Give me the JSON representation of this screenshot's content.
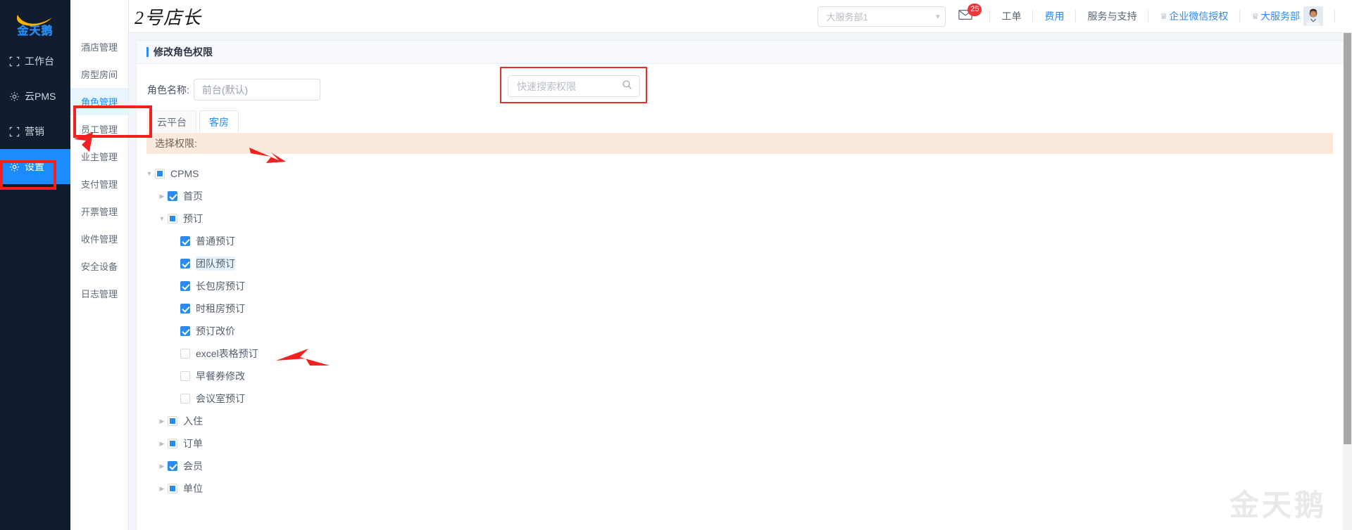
{
  "brand": {
    "name": "金天鹅",
    "logo_icon": "swan-swoosh-logo"
  },
  "rail": {
    "items": [
      {
        "label": "工作台",
        "icon": "workbench-icon",
        "active": false
      },
      {
        "label": "云PMS",
        "icon": "gear-icon",
        "active": false
      },
      {
        "label": "营销",
        "icon": "marketing-icon",
        "active": false
      },
      {
        "label": "设置",
        "icon": "gear-icon",
        "active": true
      }
    ]
  },
  "submenu": {
    "items": [
      {
        "label": "酒店管理",
        "active": false
      },
      {
        "label": "房型房间",
        "active": false
      },
      {
        "label": "角色管理",
        "active": true
      },
      {
        "label": "员工管理",
        "active": false
      },
      {
        "label": "业主管理",
        "active": false
      },
      {
        "label": "支付管理",
        "active": false
      },
      {
        "label": "开票管理",
        "active": false
      },
      {
        "label": "收件管理",
        "active": false
      },
      {
        "label": "安全设备",
        "active": false
      },
      {
        "label": "日志管理",
        "active": false
      }
    ]
  },
  "header": {
    "page_title": "2号店长",
    "dept_select": {
      "value": "大服务部1",
      "caret_icon": "chevron-down-icon"
    },
    "mail": {
      "icon": "mail-icon",
      "badge": "25"
    },
    "links": [
      {
        "label": "工单",
        "style": "grey"
      },
      {
        "label": "费用",
        "style": "blue"
      },
      {
        "label": "服务与支持",
        "style": "grey"
      }
    ],
    "wecom_auth": {
      "label": "企业微信授权",
      "icon": "user-icon"
    },
    "account": {
      "label": "大服务部",
      "icon": "user-icon",
      "avatar": "avatar-photo"
    }
  },
  "card": {
    "title": "修改角色权限",
    "role_name_label": "角色名称:",
    "role_name_value": "前台(默认)",
    "search": {
      "placeholder": "快速搜索权限",
      "icon": "search-icon",
      "highlighted": true
    },
    "tabs": [
      {
        "label": "云平台",
        "active": false
      },
      {
        "label": "客房",
        "active": true
      }
    ],
    "perm_header": "选择权限:"
  },
  "tree": [
    {
      "label": "CPMS",
      "depth": 0,
      "state": "indeterminate",
      "arrow": "down",
      "selected": false
    },
    {
      "label": "首页",
      "depth": 1,
      "state": "checked",
      "arrow": "right",
      "selected": false
    },
    {
      "label": "预订",
      "depth": 1,
      "state": "indeterminate",
      "arrow": "down",
      "selected": false
    },
    {
      "label": "普通预订",
      "depth": 2,
      "state": "checked",
      "arrow": "none",
      "selected": false
    },
    {
      "label": "团队预订",
      "depth": 2,
      "state": "checked",
      "arrow": "none",
      "selected": true
    },
    {
      "label": "长包房预订",
      "depth": 2,
      "state": "checked",
      "arrow": "none",
      "selected": false
    },
    {
      "label": "时租房预订",
      "depth": 2,
      "state": "checked",
      "arrow": "none",
      "selected": false
    },
    {
      "label": "预订改价",
      "depth": 2,
      "state": "checked",
      "arrow": "none",
      "selected": false
    },
    {
      "label": "excel表格预订",
      "depth": 2,
      "state": "unchecked",
      "arrow": "none",
      "selected": false
    },
    {
      "label": "早餐券修改",
      "depth": 2,
      "state": "unchecked",
      "arrow": "none",
      "selected": false
    },
    {
      "label": "会议室预订",
      "depth": 2,
      "state": "unchecked",
      "arrow": "none",
      "selected": false
    },
    {
      "label": "入住",
      "depth": 1,
      "state": "indeterminate",
      "arrow": "right",
      "selected": false
    },
    {
      "label": "订单",
      "depth": 1,
      "state": "indeterminate",
      "arrow": "right",
      "selected": false
    },
    {
      "label": "会员",
      "depth": 1,
      "state": "checked",
      "arrow": "right",
      "selected": false
    },
    {
      "label": "单位",
      "depth": 1,
      "state": "indeterminate",
      "arrow": "right",
      "selected": false
    }
  ],
  "annotations": {
    "color": "#f42020",
    "boxes": [
      "settings-rail-item",
      "role-management-submenu-item",
      "permission-search-box"
    ],
    "arrows": [
      "arrow-to-role-management",
      "arrow-to-keting-tab",
      "arrow-to-yuding-gaijia"
    ]
  },
  "watermark": {
    "text": "金天鹅"
  },
  "colors": {
    "accent_blue": "#2a8cf0",
    "rail_dark": "#111c2e",
    "annotation_red": "#f42020",
    "perm_band": "#fbeadb",
    "badge_red": "#e8393b"
  }
}
